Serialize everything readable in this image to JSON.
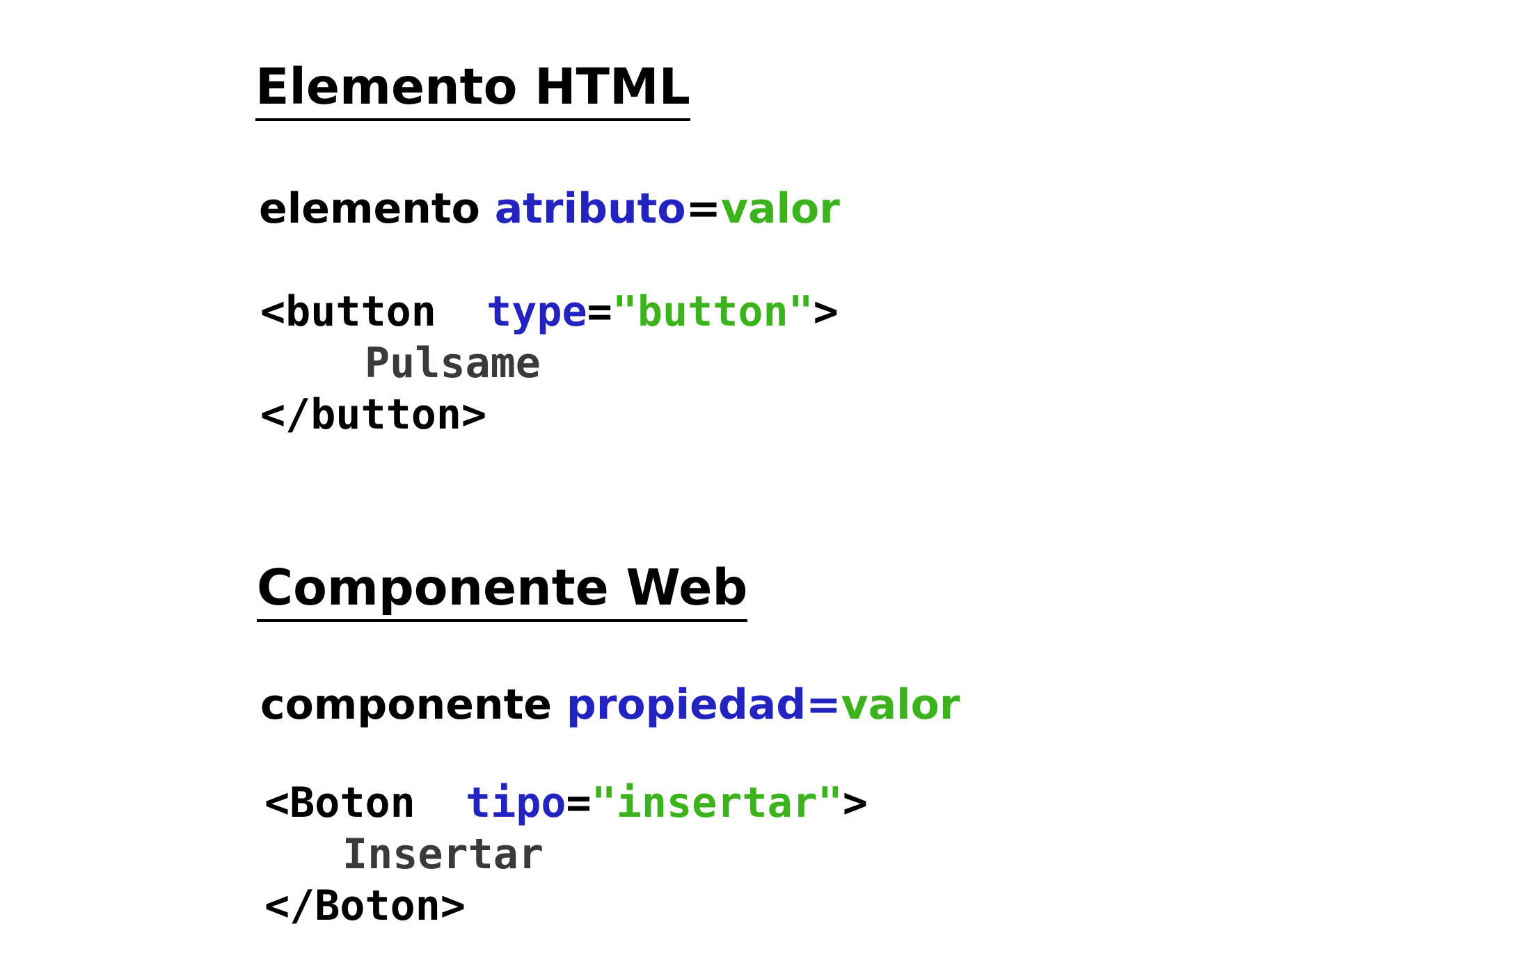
{
  "colors": {
    "keyword": "#000000",
    "attribute": "#2323c0",
    "value": "#3cb21c",
    "content": "#3a3a3a"
  },
  "html_section": {
    "title": "Elemento HTML",
    "signature": {
      "element": "elemento",
      "attribute": "atributo",
      "equals": "=",
      "value": "valor"
    },
    "code": {
      "open_tag": "<button",
      "attribute": "type",
      "equals": "=",
      "value": "\"button\"",
      "open_close": ">",
      "content": "Pulsame",
      "close_tag": "</button>"
    }
  },
  "component_section": {
    "title": "Componente Web",
    "signature": {
      "element": "componente",
      "attribute": "propiedad=",
      "value": "valor"
    },
    "code": {
      "open_tag": "<Boton",
      "attribute": "tipo",
      "equals": "=",
      "value": "\"insertar\"",
      "open_close": ">",
      "content": "Insertar",
      "close_tag": "</Boton>"
    }
  }
}
